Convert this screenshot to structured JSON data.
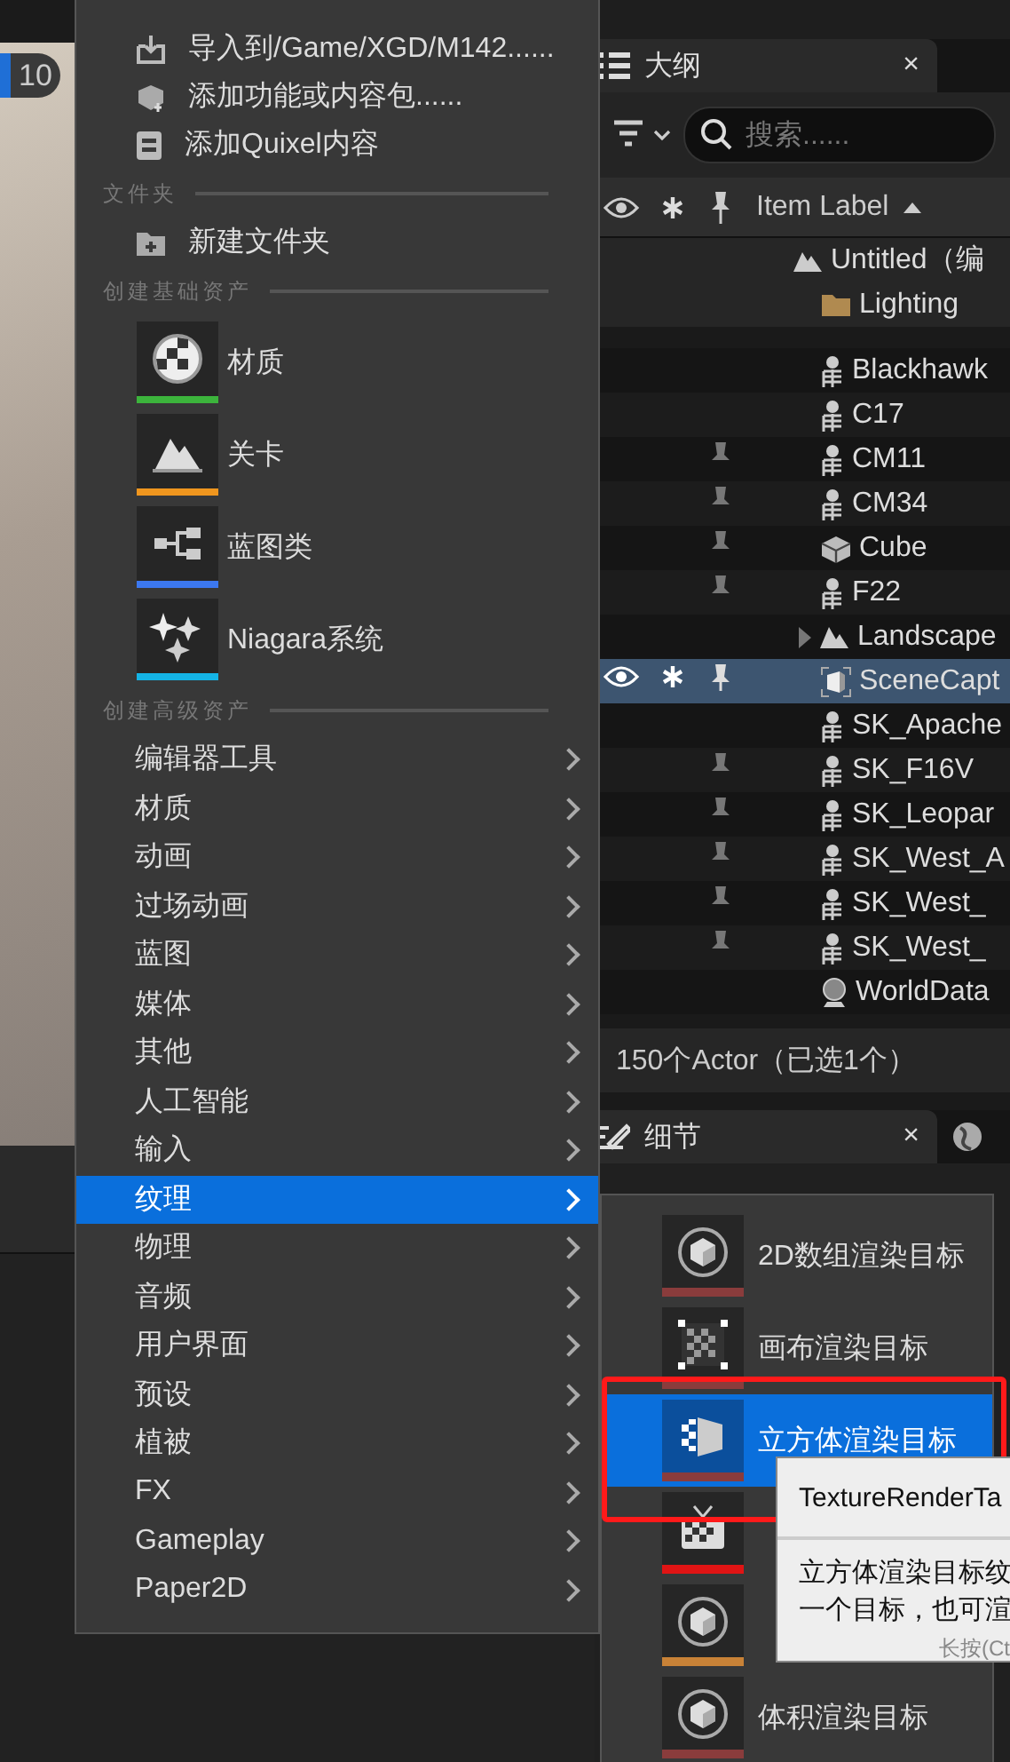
{
  "viewport": {
    "badge": "10"
  },
  "context_menu": {
    "sections": [
      {
        "items": [
          {
            "kind": "action",
            "label": "导入到/Game/XGD/M142......"
          },
          {
            "kind": "action",
            "label": "添加功能或内容包......"
          },
          {
            "kind": "action",
            "label": "添加Quixel内容"
          }
        ]
      },
      {
        "header": "文件夹",
        "items": [
          {
            "kind": "action",
            "label": "新建文件夹"
          }
        ]
      },
      {
        "header": "创建基础资产",
        "items": [
          {
            "kind": "asset",
            "label": "材质",
            "color": "#3cb43c"
          },
          {
            "kind": "asset",
            "label": "关卡",
            "color": "#f0961e"
          },
          {
            "kind": "asset",
            "label": "蓝图类",
            "color": "#3c78f0"
          },
          {
            "kind": "asset",
            "label": "Niagara系统",
            "color": "#14b4e6"
          }
        ]
      },
      {
        "header": "创建高级资产",
        "items": [
          {
            "kind": "submenu",
            "label": "编辑器工具",
            "selected": false
          },
          {
            "kind": "submenu",
            "label": "材质",
            "selected": false
          },
          {
            "kind": "submenu",
            "label": "动画",
            "selected": false
          },
          {
            "kind": "submenu",
            "label": "过场动画",
            "selected": false
          },
          {
            "kind": "submenu",
            "label": "蓝图",
            "selected": false
          },
          {
            "kind": "submenu",
            "label": "媒体",
            "selected": false
          },
          {
            "kind": "submenu",
            "label": "其他",
            "selected": false
          },
          {
            "kind": "submenu",
            "label": "人工智能",
            "selected": false
          },
          {
            "kind": "submenu",
            "label": "输入",
            "selected": false
          },
          {
            "kind": "submenu",
            "label": "纹理",
            "selected": true
          },
          {
            "kind": "submenu",
            "label": "物理",
            "selected": false
          },
          {
            "kind": "submenu",
            "label": "音频",
            "selected": false
          },
          {
            "kind": "submenu",
            "label": "用户界面",
            "selected": false
          },
          {
            "kind": "submenu",
            "label": "预设",
            "selected": false
          },
          {
            "kind": "submenu",
            "label": "植被",
            "selected": false
          },
          {
            "kind": "submenu",
            "label": "FX",
            "selected": false
          },
          {
            "kind": "submenu",
            "label": "Gameplay",
            "selected": false
          },
          {
            "kind": "submenu",
            "label": "Paper2D",
            "selected": false
          }
        ]
      }
    ]
  },
  "submenu": {
    "items": [
      {
        "kind": "cube",
        "label": "2D数组渲染目标",
        "color": "#8a3c3c",
        "selected": false,
        "highlighted": false
      },
      {
        "kind": "checker",
        "label": "画布渲染目标",
        "color": "#8a3c3c",
        "selected": false,
        "highlighted": false
      },
      {
        "kind": "cubemap",
        "label": "立方体渲染目标",
        "color": "#8a3c3c",
        "selected": true,
        "highlighted": true
      },
      {
        "kind": "tv",
        "color": "#e01414",
        "selected": false,
        "highlighted": false
      },
      {
        "kind": "cube",
        "color": "#c88237",
        "selected": false,
        "highlighted": false
      },
      {
        "kind": "cube",
        "label": "体积渲染目标",
        "color": "#8a3c3c",
        "selected": false,
        "highlighted": false
      }
    ]
  },
  "tooltip": {
    "title": "TextureRenderTa",
    "lines": [
      "立方体渲染目标纹",
      "一个目标，也可渲"
    ],
    "hint": "长按(Ct"
  },
  "outliner": {
    "tab": {
      "title": "大纲",
      "close": "×"
    },
    "search": {
      "placeholder": "搜索......"
    },
    "columns": {
      "label": "Item Label"
    },
    "root": {
      "label": "Untitled（编",
      "children": [
        {
          "kind": "folder",
          "label": "Lighting",
          "pinned": false,
          "selected": false,
          "has_children": false
        },
        {
          "kind": "skeleton",
          "label": "Blackhawk",
          "pinned": false,
          "selected": false,
          "has_children": false
        },
        {
          "kind": "skeleton",
          "label": "C17",
          "pinned": false,
          "selected": false,
          "has_children": false
        },
        {
          "kind": "skeleton",
          "label": "CM11",
          "pinned": true,
          "selected": false,
          "has_children": false
        },
        {
          "kind": "skeleton",
          "label": "CM34",
          "pinned": true,
          "selected": false,
          "has_children": false
        },
        {
          "kind": "cube",
          "label": "Cube",
          "pinned": true,
          "selected": false,
          "has_children": false
        },
        {
          "kind": "skeleton",
          "label": "F22",
          "pinned": true,
          "selected": false,
          "has_children": false
        },
        {
          "kind": "landscape",
          "label": "Landscape",
          "pinned": false,
          "selected": false,
          "has_children": true
        },
        {
          "kind": "capture",
          "label": "SceneCapt",
          "pinned": true,
          "selected": true,
          "has_children": false
        },
        {
          "kind": "skeleton",
          "label": "SK_Apache",
          "pinned": false,
          "selected": false,
          "has_children": false
        },
        {
          "kind": "skeleton",
          "label": "SK_F16V",
          "pinned": true,
          "selected": false,
          "has_children": false
        },
        {
          "kind": "skeleton",
          "label": "SK_Leopar",
          "pinned": true,
          "selected": false,
          "has_children": false
        },
        {
          "kind": "skeleton",
          "label": "SK_West_A",
          "pinned": true,
          "selected": false,
          "has_children": false
        },
        {
          "kind": "skeleton",
          "label": "SK_West_",
          "pinned": true,
          "selected": false,
          "has_children": false
        },
        {
          "kind": "skeleton",
          "label": "SK_West_",
          "pinned": true,
          "selected": false,
          "has_children": false
        },
        {
          "kind": "sphere",
          "label": "WorldData",
          "pinned": false,
          "selected": false,
          "has_children": false
        }
      ]
    },
    "status": "150个Actor（已选1个）"
  },
  "details_panel": {
    "tab": {
      "title": "细节",
      "close": "×"
    }
  }
}
